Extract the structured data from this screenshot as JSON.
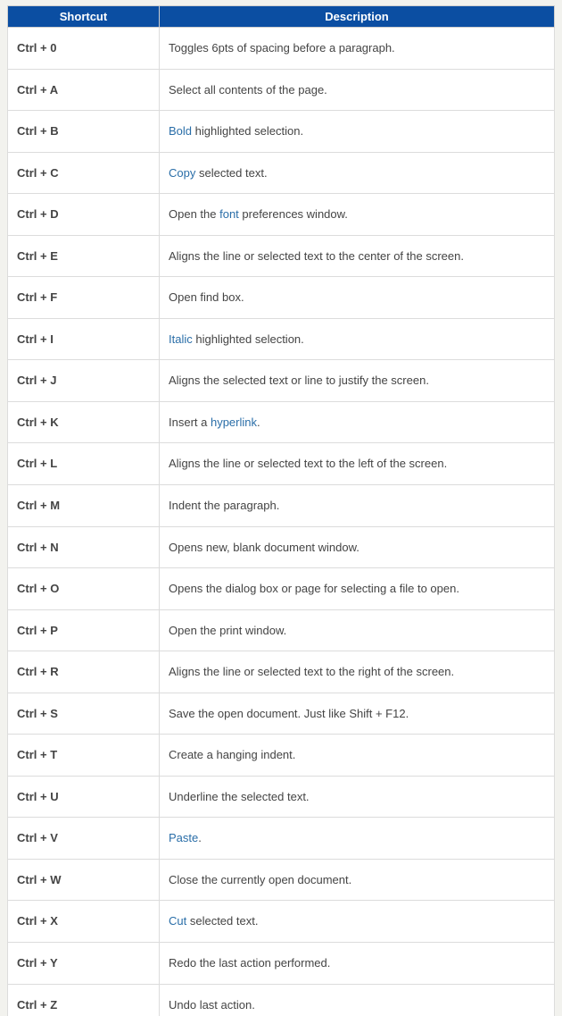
{
  "table": {
    "headers": {
      "shortcut": "Shortcut",
      "description": "Description"
    },
    "rows": [
      {
        "shortcut": "Ctrl + 0",
        "desc": [
          {
            "t": "text",
            "v": "Toggles 6pts of spacing before a paragraph."
          }
        ]
      },
      {
        "shortcut": "Ctrl + A",
        "desc": [
          {
            "t": "text",
            "v": "Select all contents of the page."
          }
        ]
      },
      {
        "shortcut": "Ctrl + B",
        "desc": [
          {
            "t": "link",
            "v": "Bold"
          },
          {
            "t": "text",
            "v": " highlighted selection."
          }
        ]
      },
      {
        "shortcut": "Ctrl + C",
        "desc": [
          {
            "t": "link",
            "v": "Copy"
          },
          {
            "t": "text",
            "v": " selected text."
          }
        ]
      },
      {
        "shortcut": "Ctrl + D",
        "desc": [
          {
            "t": "text",
            "v": "Open the "
          },
          {
            "t": "link",
            "v": "font"
          },
          {
            "t": "text",
            "v": " preferences window."
          }
        ]
      },
      {
        "shortcut": "Ctrl + E",
        "desc": [
          {
            "t": "text",
            "v": "Aligns the line or selected text to the center of the screen."
          }
        ]
      },
      {
        "shortcut": "Ctrl + F",
        "desc": [
          {
            "t": "text",
            "v": "Open find box."
          }
        ]
      },
      {
        "shortcut": "Ctrl + I",
        "desc": [
          {
            "t": "link",
            "v": "Italic"
          },
          {
            "t": "text",
            "v": " highlighted selection."
          }
        ]
      },
      {
        "shortcut": "Ctrl + J",
        "desc": [
          {
            "t": "text",
            "v": "Aligns the selected text or line to justify the screen."
          }
        ]
      },
      {
        "shortcut": "Ctrl + K",
        "desc": [
          {
            "t": "text",
            "v": "Insert a "
          },
          {
            "t": "link",
            "v": "hyperlink"
          },
          {
            "t": "text",
            "v": "."
          }
        ]
      },
      {
        "shortcut": "Ctrl + L",
        "desc": [
          {
            "t": "text",
            "v": "Aligns the line or selected text to the left of the screen."
          }
        ]
      },
      {
        "shortcut": "Ctrl + M",
        "desc": [
          {
            "t": "text",
            "v": "Indent the paragraph."
          }
        ]
      },
      {
        "shortcut": "Ctrl + N",
        "desc": [
          {
            "t": "text",
            "v": "Opens new, blank document window."
          }
        ]
      },
      {
        "shortcut": "Ctrl + O",
        "desc": [
          {
            "t": "text",
            "v": "Opens the dialog box or page for selecting a file to open."
          }
        ]
      },
      {
        "shortcut": "Ctrl + P",
        "desc": [
          {
            "t": "text",
            "v": "Open the print window."
          }
        ]
      },
      {
        "shortcut": "Ctrl + R",
        "desc": [
          {
            "t": "text",
            "v": "Aligns the line or selected text to the right of the screen."
          }
        ]
      },
      {
        "shortcut": "Ctrl + S",
        "desc": [
          {
            "t": "text",
            "v": "Save the open document. Just like Shift + F12."
          }
        ]
      },
      {
        "shortcut": "Ctrl + T",
        "desc": [
          {
            "t": "text",
            "v": "Create a hanging indent."
          }
        ]
      },
      {
        "shortcut": "Ctrl + U",
        "desc": [
          {
            "t": "text",
            "v": "Underline the selected text."
          }
        ]
      },
      {
        "shortcut": "Ctrl + V",
        "desc": [
          {
            "t": "link",
            "v": "Paste"
          },
          {
            "t": "text",
            "v": "."
          }
        ]
      },
      {
        "shortcut": "Ctrl + W",
        "desc": [
          {
            "t": "text",
            "v": "Close the currently open document."
          }
        ]
      },
      {
        "shortcut": "Ctrl + X",
        "desc": [
          {
            "t": "link",
            "v": "Cut"
          },
          {
            "t": "text",
            "v": " selected text."
          }
        ]
      },
      {
        "shortcut": "Ctrl + Y",
        "desc": [
          {
            "t": "text",
            "v": "Redo the last action performed."
          }
        ]
      },
      {
        "shortcut": "Ctrl + Z",
        "desc": [
          {
            "t": "text",
            "v": "Undo last action."
          }
        ]
      }
    ]
  }
}
